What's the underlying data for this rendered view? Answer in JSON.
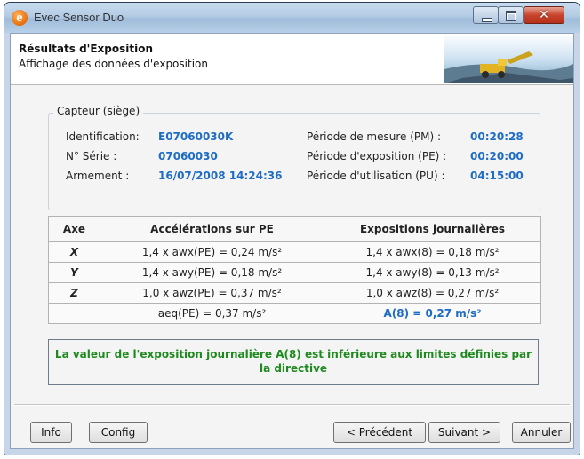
{
  "window": {
    "title": "Evec Sensor Duo",
    "app_icon": "e",
    "colors": {
      "value_blue": "#1f6cc4",
      "success_green": "#1e8a1e"
    }
  },
  "header": {
    "title": "Résultats d'Exposition",
    "subtitle": "Affichage des données d'exposition",
    "banner_icon": "industrial-machinery-image"
  },
  "sensor": {
    "group_label": "Capteur (siège)",
    "identification_label": "Identification:",
    "identification_value": "E07060030K",
    "serial_label": "N° Série :",
    "serial_value": "07060030",
    "armement_label": "Armement :",
    "armement_value": "16/07/2008 14:24:36",
    "pm_label": "Période de mesure (PM) :",
    "pm_value": "00:20:28",
    "pe_label": "Période d'exposition (PE) :",
    "pe_value": "00:20:00",
    "pu_label": "Période d'utilisation (PU) :",
    "pu_value": "04:15:00"
  },
  "table": {
    "headers": [
      "Axe",
      "Accélérations sur PE",
      "Expositions journalières"
    ],
    "rows": [
      [
        "X",
        "1,4 x awx(PE) = 0,24 m/s²",
        "1,4 x awx(8) = 0,18 m/s²"
      ],
      [
        "Y",
        "1,4 x awy(PE) = 0,18 m/s²",
        "1,4 x awy(8) = 0,13 m/s²"
      ],
      [
        "Z",
        "1,0 x awz(PE) = 0,37 m/s²",
        "1,0 x awz(8) = 0,27 m/s²"
      ]
    ],
    "aeq": "aeq(PE) = 0,37 m/s²",
    "a8": "A(8) = 0,27 m/s²"
  },
  "message": "La valeur de l'exposition journalière A(8) est inférieure aux limites définies par la directive",
  "buttons": {
    "info": "Info",
    "config": "Config",
    "previous": "< Précédent",
    "next": "Suivant >",
    "cancel": "Annuler"
  }
}
